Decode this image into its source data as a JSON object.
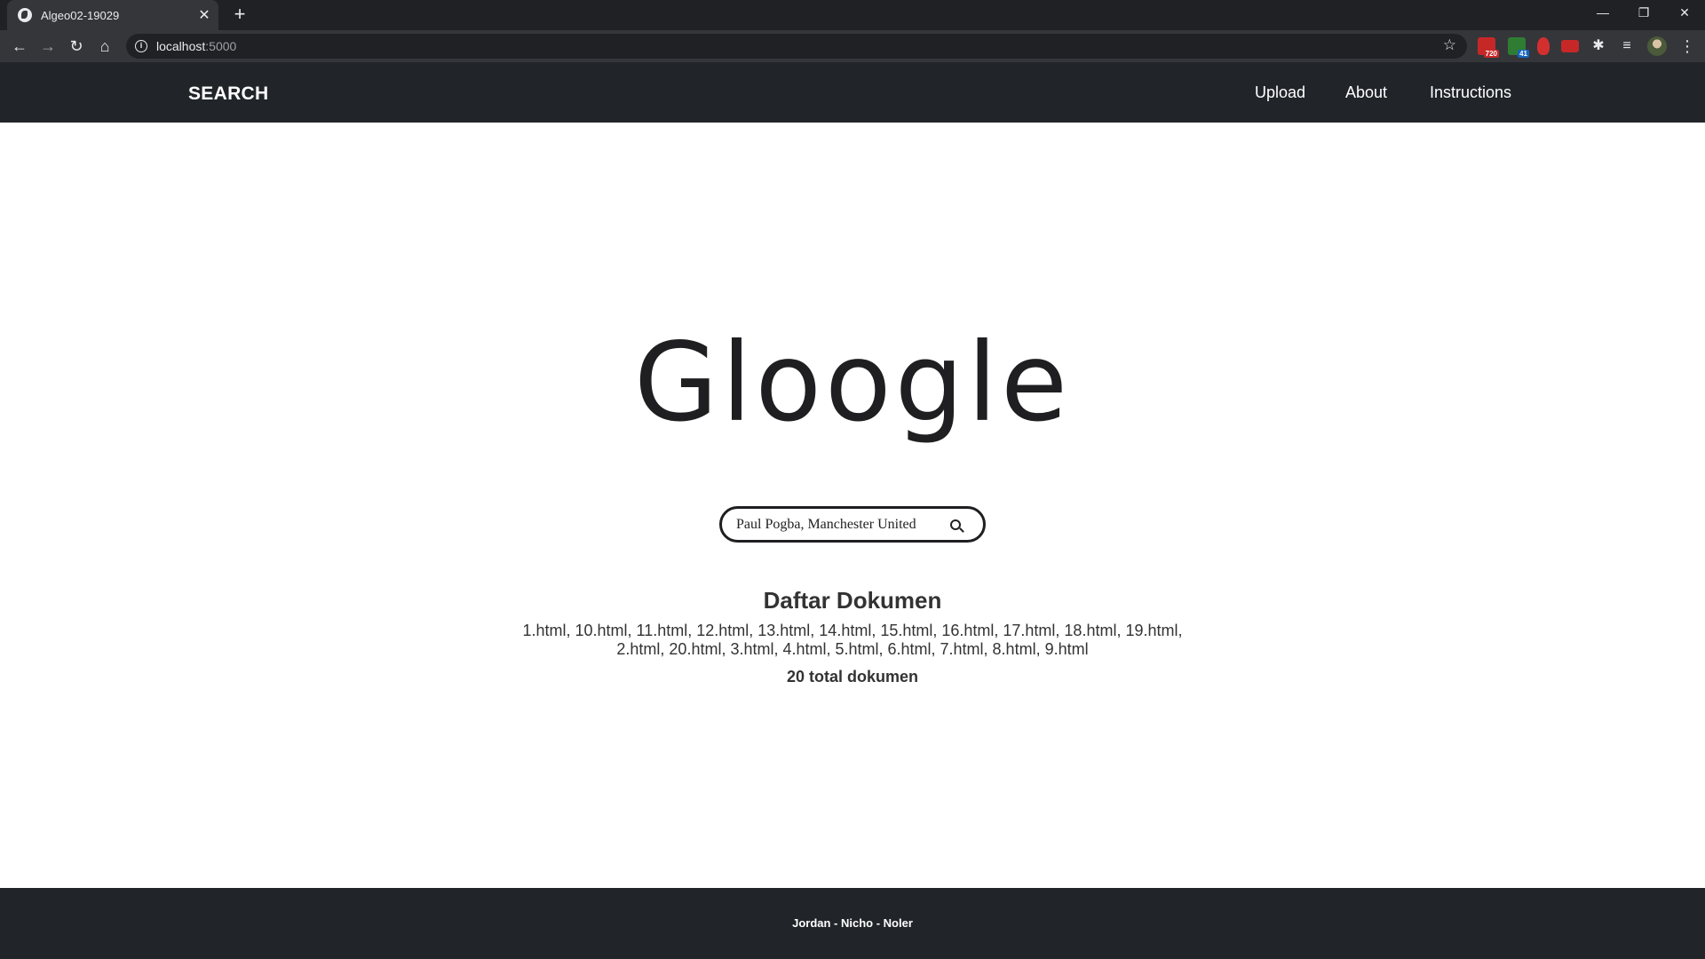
{
  "browser": {
    "tab_title": "Algeo02-19029",
    "tab_close": "✕",
    "new_tab": "+",
    "url_host": "localhost",
    "url_port": ":5000",
    "window_controls": [
      "—",
      "❐",
      "✕"
    ],
    "extensions": [
      {
        "name": "extension-720-icon",
        "badge": "720",
        "color": "#c62828"
      },
      {
        "name": "extension-41-icon",
        "badge": "41",
        "color": "#2e7d32"
      },
      {
        "name": "extension-hand-icon",
        "badge": "",
        "color": "#d32f2f"
      },
      {
        "name": "extension-dots-icon",
        "badge": "",
        "color": "#c62828"
      }
    ]
  },
  "navbar": {
    "brand": "SEARCH",
    "links": [
      "Upload",
      "About",
      "Instructions"
    ]
  },
  "main": {
    "logo": "Gloogle",
    "search": {
      "value": "Paul Pogba, Manchester United"
    },
    "documents": {
      "title": "Daftar Dokumen",
      "list_line1": "1.html, 10.html, 11.html, 12.html, 13.html, 14.html, 15.html, 16.html, 17.html, 18.html, 19.html,",
      "list_line2": "2.html, 20.html, 3.html, 4.html, 5.html, 6.html, 7.html, 8.html, 9.html",
      "total": "20 total dokumen"
    }
  },
  "footer": {
    "credits": "Jordan - Nicho - Noler"
  },
  "colors": {
    "navbar_bg": "#212529",
    "chrome_tabbar": "#202124",
    "chrome_toolbar": "#35363a"
  }
}
